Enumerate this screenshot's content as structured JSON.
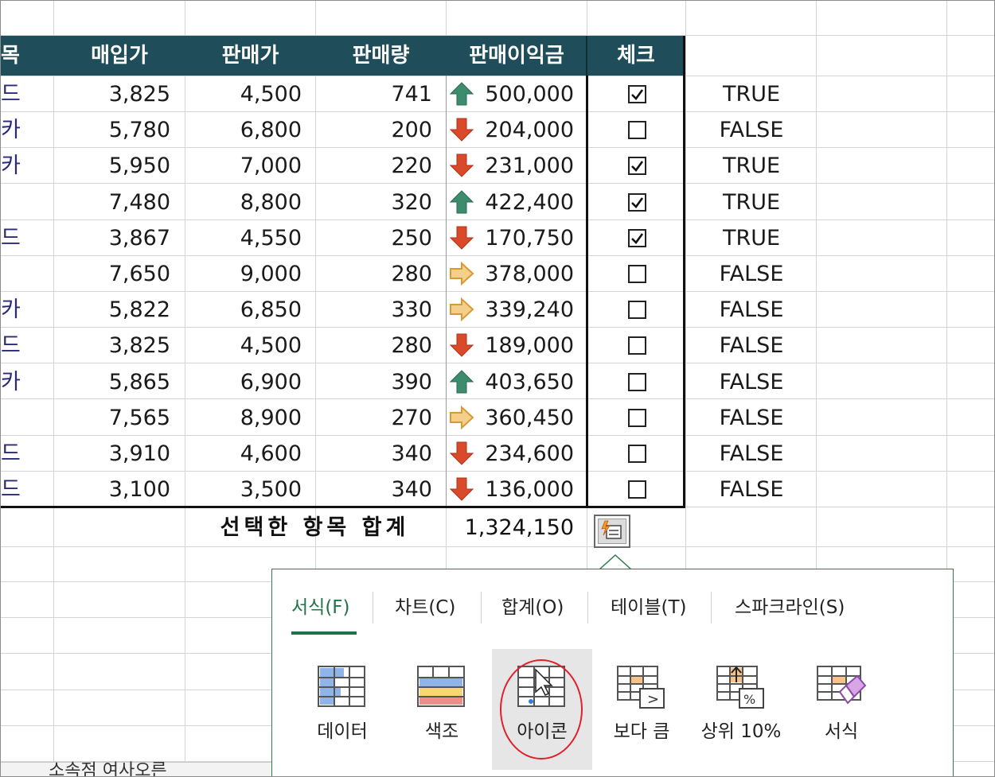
{
  "headers": [
    {
      "key": "col_a",
      "label": "목"
    },
    {
      "key": "col_b",
      "label": "매입가"
    },
    {
      "key": "col_c",
      "label": "판매가"
    },
    {
      "key": "col_d",
      "label": "판매량"
    },
    {
      "key": "col_e",
      "label": "판매이익금"
    },
    {
      "key": "col_f",
      "label": "체크"
    }
  ],
  "rows": [
    {
      "item": "드",
      "buy": "3,825",
      "sell": "4,500",
      "qty": "741",
      "profit": "500,000",
      "trend": "up",
      "checked": true,
      "flag": "TRUE"
    },
    {
      "item": "카",
      "buy": "5,780",
      "sell": "6,800",
      "qty": "200",
      "profit": "204,000",
      "trend": "down",
      "checked": false,
      "flag": "FALSE"
    },
    {
      "item": "카",
      "buy": "5,950",
      "sell": "7,000",
      "qty": "220",
      "profit": "231,000",
      "trend": "down",
      "checked": true,
      "flag": "TRUE"
    },
    {
      "item": "",
      "buy": "7,480",
      "sell": "8,800",
      "qty": "320",
      "profit": "422,400",
      "trend": "up",
      "checked": true,
      "flag": "TRUE"
    },
    {
      "item": "드",
      "buy": "3,867",
      "sell": "4,550",
      "qty": "250",
      "profit": "170,750",
      "trend": "down",
      "checked": true,
      "flag": "TRUE"
    },
    {
      "item": "",
      "buy": "7,650",
      "sell": "9,000",
      "qty": "280",
      "profit": "378,000",
      "trend": "right",
      "checked": false,
      "flag": "FALSE"
    },
    {
      "item": "카",
      "buy": "5,822",
      "sell": "6,850",
      "qty": "330",
      "profit": "339,240",
      "trend": "right",
      "checked": false,
      "flag": "FALSE"
    },
    {
      "item": "드",
      "buy": "3,825",
      "sell": "4,500",
      "qty": "280",
      "profit": "189,000",
      "trend": "down",
      "checked": false,
      "flag": "FALSE"
    },
    {
      "item": "카",
      "buy": "5,865",
      "sell": "6,900",
      "qty": "390",
      "profit": "403,650",
      "trend": "up",
      "checked": false,
      "flag": "FALSE"
    },
    {
      "item": "",
      "buy": "7,565",
      "sell": "8,900",
      "qty": "270",
      "profit": "360,450",
      "trend": "right",
      "checked": false,
      "flag": "FALSE"
    },
    {
      "item": "드",
      "buy": "3,910",
      "sell": "4,600",
      "qty": "340",
      "profit": "234,600",
      "trend": "down",
      "checked": false,
      "flag": "FALSE"
    },
    {
      "item": "드",
      "buy": "3,100",
      "sell": "3,500",
      "qty": "340",
      "profit": "136,000",
      "trend": "down",
      "checked": false,
      "flag": "FALSE"
    }
  ],
  "summary": {
    "label": "선택한 항목 합계",
    "value": "1,324,150"
  },
  "quick_analysis": {
    "tabs": [
      {
        "label": "서식(F)",
        "active": true
      },
      {
        "label": "차트(C)",
        "active": false
      },
      {
        "label": "합계(O)",
        "active": false
      },
      {
        "label": "테이블(T)",
        "active": false
      },
      {
        "label": "스파크라인(S)",
        "active": false
      }
    ],
    "options": [
      {
        "label": "데이터",
        "icon": "data-bar-icon"
      },
      {
        "label": "색조",
        "icon": "color-scale-icon"
      },
      {
        "label": "아이콘",
        "icon": "icon-set-icon",
        "highlighted": true
      },
      {
        "label": "보다 큼",
        "icon": "greater-than-icon"
      },
      {
        "label": "상위 10%",
        "icon": "top-10-percent-icon"
      },
      {
        "label": "서식",
        "icon": "clear-format-icon"
      }
    ]
  },
  "sheet_tab": "소속점 여사오른",
  "colors": {
    "header": "#1f4e5a",
    "up": "#3d8c6e",
    "down": "#d84a2a",
    "right": "#e3a545",
    "accent": "#217346"
  }
}
